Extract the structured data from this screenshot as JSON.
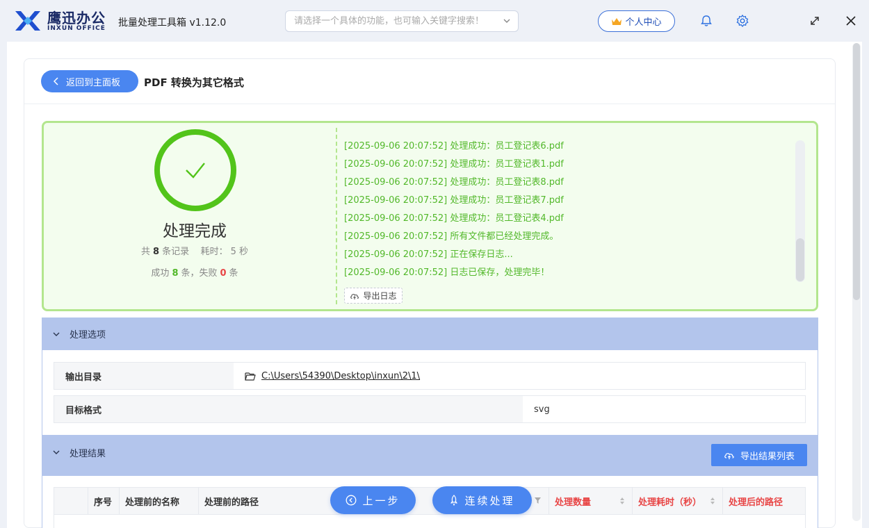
{
  "header": {
    "brand_cn": "鹰迅办公",
    "brand_en": "INXUN OFFICE",
    "app_title": "批量处理工具箱 v1.12.0",
    "search_placeholder": "请选择一个具体的功能，也可输入关键字搜索！",
    "user_center": "个人中心",
    "icons": [
      "logo-icon",
      "chevron-down-icon",
      "crown-icon",
      "bell-icon",
      "gear-icon",
      "resize-icon",
      "close-icon"
    ],
    "accent": "#4a86f0"
  },
  "page": {
    "back_label": "返回到主面板",
    "title": "PDF 转换为其它格式"
  },
  "summary": {
    "status": "处理完成",
    "total_prefix": "共",
    "total": "8",
    "total_suffix": "条记录",
    "time_prefix": "耗时：",
    "time": "5",
    "time_suffix": "秒",
    "success_prefix": "成功",
    "success": "8",
    "success_mid": "条，失败",
    "fail": "0",
    "fail_suffix": "条",
    "success_color": "#52b82a",
    "fail_color": "#e84545"
  },
  "log": {
    "lines": [
      "[2025-09-06 20:07:52] 处理成功：员工登记表6.pdf",
      "[2025-09-06 20:07:52] 处理成功：员工登记表1.pdf",
      "[2025-09-06 20:07:52] 处理成功：员工登记表8.pdf",
      "[2025-09-06 20:07:52] 处理成功：员工登记表7.pdf",
      "[2025-09-06 20:07:52] 处理成功：员工登记表4.pdf",
      "[2025-09-06 20:07:52] 所有文件都已经处理完成。",
      "[2025-09-06 20:07:52] 正在保存日志...",
      "[2025-09-06 20:07:52] 日志已保存，处理完毕！"
    ],
    "export_label": "导出日志"
  },
  "options": {
    "section_title": "处理选项",
    "output_dir_label": "输出目录",
    "output_dir_value": "C:\\Users\\54390\\Desktop\\inxun\\2\\1\\",
    "target_format_label": "目标格式",
    "target_format_value": "svg"
  },
  "results": {
    "section_title": "处理结果",
    "export_label": "导出结果列表",
    "columns": [
      "序号",
      "处理前的名称",
      "处理前的路径",
      "处理数量",
      "处理耗时（秒）",
      "处理后的路径"
    ]
  },
  "actions": {
    "prev_label": "上一步",
    "continue_label": "连续处理"
  }
}
